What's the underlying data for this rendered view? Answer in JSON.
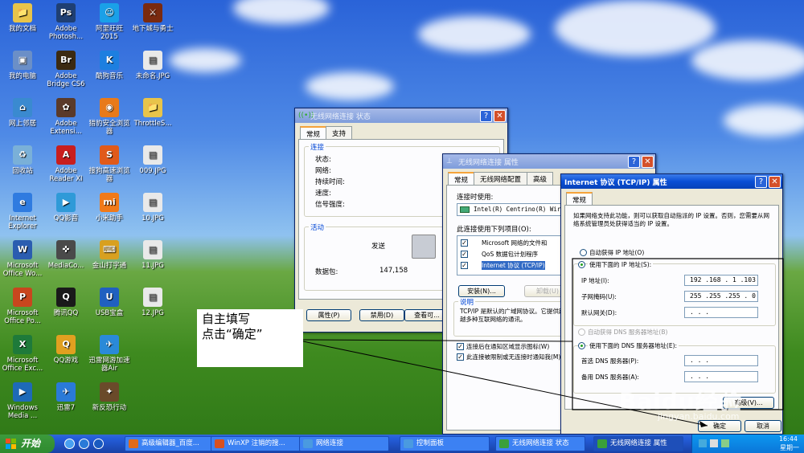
{
  "desktop_icons": [
    {
      "label": "我的文档",
      "color": "#e8c44a",
      "glyph": "📁"
    },
    {
      "label": "Adobe Photosh...",
      "color": "#1f3f73",
      "glyph": "Ps"
    },
    {
      "label": "阿里旺旺 2015",
      "color": "#1aa0e8",
      "glyph": "☺"
    },
    {
      "label": "地下城与勇士",
      "color": "#7a2a10",
      "glyph": "⚔"
    },
    {
      "label": "我的电脑",
      "color": "#6b8fc7",
      "glyph": "▣"
    },
    {
      "label": "Adobe Bridge CS6",
      "color": "#3b2a12",
      "glyph": "Br"
    },
    {
      "label": "酷狗音乐",
      "color": "#1d7fe0",
      "glyph": "K"
    },
    {
      "label": "未命名.JPG",
      "color": "#e9e9e9",
      "glyph": "▤"
    },
    {
      "label": "网上邻居",
      "color": "#3a8ad0",
      "glyph": "⌂"
    },
    {
      "label": "Adobe Extensi...",
      "color": "#5a3a2a",
      "glyph": "✿"
    },
    {
      "label": "猎豹安全浏览器",
      "color": "#e87a1a",
      "glyph": "◉"
    },
    {
      "label": "ThrottleS...",
      "color": "#e8c44a",
      "glyph": "📁"
    },
    {
      "label": "回收站",
      "color": "#7ab0d8",
      "glyph": "♻"
    },
    {
      "label": "Adobe Reader XI",
      "color": "#c81e1e",
      "glyph": "A"
    },
    {
      "label": "搜狗高速浏览器",
      "color": "#e05a1a",
      "glyph": "S"
    },
    {
      "label": "009.JPG",
      "color": "#e9e9e9",
      "glyph": "▤"
    },
    {
      "label": "Internet Explorer",
      "color": "#2f7be0",
      "glyph": "e"
    },
    {
      "label": "QQ影音",
      "color": "#2f9ad8",
      "glyph": "▶"
    },
    {
      "label": "小米助手",
      "color": "#f07a1a",
      "glyph": "mi"
    },
    {
      "label": "10.JPG",
      "color": "#e9e9e9",
      "glyph": "▤"
    },
    {
      "label": "Microsoft Office Wo...",
      "color": "#2b5db0",
      "glyph": "W"
    },
    {
      "label": "MediaCo...",
      "color": "#4a4a4a",
      "glyph": "✜"
    },
    {
      "label": "金山打字通",
      "color": "#d8a020",
      "glyph": "⌨"
    },
    {
      "label": "11.JPG",
      "color": "#e9e9e9",
      "glyph": "▤"
    },
    {
      "label": "Microsoft Office Po...",
      "color": "#c8461e",
      "glyph": "P"
    },
    {
      "label": "腾讯QQ",
      "color": "#1a1a1a",
      "glyph": "Q"
    },
    {
      "label": "USB宝盒",
      "color": "#2060c0",
      "glyph": "U"
    },
    {
      "label": "12.JPG",
      "color": "#e9e9e9",
      "glyph": "▤"
    },
    {
      "label": "Microsoft Office Exc...",
      "color": "#1e7a3a",
      "glyph": "X"
    },
    {
      "label": "QQ游戏",
      "color": "#e0a020",
      "glyph": "Q"
    },
    {
      "label": "迅雷网游加速器Air",
      "color": "#2a8ad8",
      "glyph": "✈"
    },
    {
      "label": "",
      "color": "transparent",
      "glyph": ""
    },
    {
      "label": "Windows Media ...",
      "color": "#1e6ab8",
      "glyph": "▶"
    },
    {
      "label": "迅雷7",
      "color": "#2a7ad8",
      "glyph": "✈"
    },
    {
      "label": "新反恐行动",
      "color": "#6a4a2a",
      "glyph": "✦"
    },
    {
      "label": "",
      "color": "transparent",
      "glyph": ""
    }
  ],
  "status_window": {
    "title": "无线网络连接 状态",
    "tabs": [
      "常规",
      "支持"
    ],
    "group_connect": "连接",
    "rows": [
      {
        "label": "状态:",
        "value": ""
      },
      {
        "label": "网络:",
        "value": ""
      },
      {
        "label": "持续时间:",
        "value": ""
      },
      {
        "label": "速度:",
        "value": ""
      },
      {
        "label": "信号强度:",
        "value": ""
      }
    ],
    "group_activity": "活动",
    "sent_label": "发送",
    "packets_label": "数据包:",
    "packets_value": "147,158",
    "buttons": [
      "属性(P)",
      "禁用(D)",
      "查看可..."
    ]
  },
  "props_window": {
    "title": "无线网络连接 属性",
    "tabs": [
      "常规",
      "无线网络配置",
      "高级"
    ],
    "connect_using": "连接时使用:",
    "adapter": "Intel(R) Centrino(R) Wir",
    "items_label": "此连接使用下列项目(O):",
    "items": [
      {
        "label": "Microsoft 网络的文件和",
        "checked": "✓"
      },
      {
        "label": "QoS 数据包计划程序",
        "checked": "✓"
      },
      {
        "label": "Internet 协议 (TCP/IP)",
        "checked": "✓"
      }
    ],
    "install_button": "安装(N)...",
    "uninstall_button": "卸载(U)",
    "description_title": "说明",
    "description": "TCP/IP 是默认的广域网协议。它提供跨越多种互联网络的通讯。",
    "check_notify": "连接后在通知区域显示图标(W)",
    "check_limited": "此连接被限制或无连接时通知我(M)"
  },
  "tcpip_window": {
    "title": "Internet 协议 (TCP/IP) 属性",
    "tab": "常规",
    "intro": "如果网络支持此功能，则可以获取自动指派的 IP 设置。否则，您需要从网络系统管理员处获得适当的 IP 设置。",
    "auto_ip": "自动获得 IP 地址(O)",
    "use_ip": "使用下面的 IP 地址(S):",
    "ip_label": "IP 地址(I):",
    "ip_value": "192 .168 . 1  .103",
    "mask_label": "子网掩码(U):",
    "mask_value": "255 .255 .255 . 0",
    "gateway_label": "默认网关(D):",
    "gateway_value": "  .     .     .",
    "auto_dns": "自动获得 DNS 服务器地址(B)",
    "use_dns": "使用下面的 DNS 服务器地址(E):",
    "dns1_label": "首选 DNS 服务器(P):",
    "dns1_value": "  .     .     .",
    "dns2_label": "备用 DNS 服务器(A):",
    "dns2_value": "  .     .     .",
    "advanced_button": "高级(V)...",
    "ok_button": "确定",
    "cancel_button": "取消"
  },
  "annotation": {
    "line1": "自主填写",
    "line2": "点击“确定”"
  },
  "watermark": {
    "brand": "Baidu经验",
    "url": "jingyan.baidu.com"
  },
  "taskbar": {
    "start": "开始",
    "items": [
      {
        "label": "高级编辑器_百度...",
        "color": "#e06a1a"
      },
      {
        "label": "WinXP 注销的搜...",
        "color": "#d85020"
      },
      {
        "label": "网络连接",
        "color": "#4a9ae0"
      },
      {
        "label": "控制面板",
        "color": "#4a9ae0"
      },
      {
        "label": "无线网络连接 状态",
        "color": "#3aa03a"
      },
      {
        "label": "无线网络连接 属性",
        "color": "#3aa03a"
      }
    ],
    "clock": "16:44",
    "day": "星期一"
  },
  "colors": {
    "title_active": "#0a4fd5",
    "close_button": "#d4502a",
    "start_green": "#3c9a3c"
  }
}
